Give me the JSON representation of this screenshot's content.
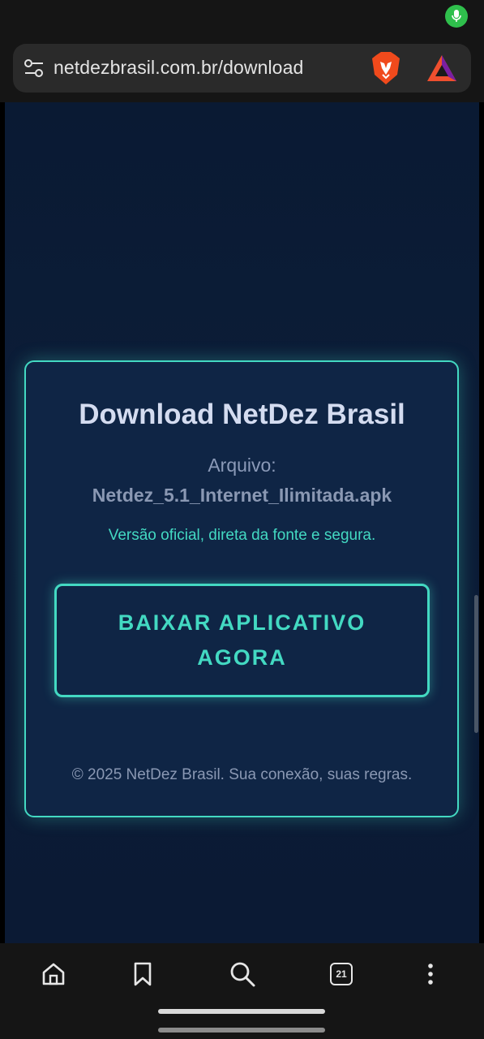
{
  "browser": {
    "url": "netdezbrasil.com.br/download"
  },
  "card": {
    "title": "Download NetDez Brasil",
    "file_label": "Arquivo:",
    "file_name": "Netdez_5.1_Internet_Ilimitada.apk",
    "note": "Versão oficial, direta da fonte e segura.",
    "download_button": "BAIXAR APLICATIVO\nAGORA",
    "footer": "© 2025 NetDez Brasil. Sua conexão, suas regras."
  },
  "bottom_nav": {
    "tab_count": "21"
  },
  "colors": {
    "accent": "#43d9c2",
    "page_bg": "#0c1d38",
    "card_bg": "#0f2545"
  }
}
